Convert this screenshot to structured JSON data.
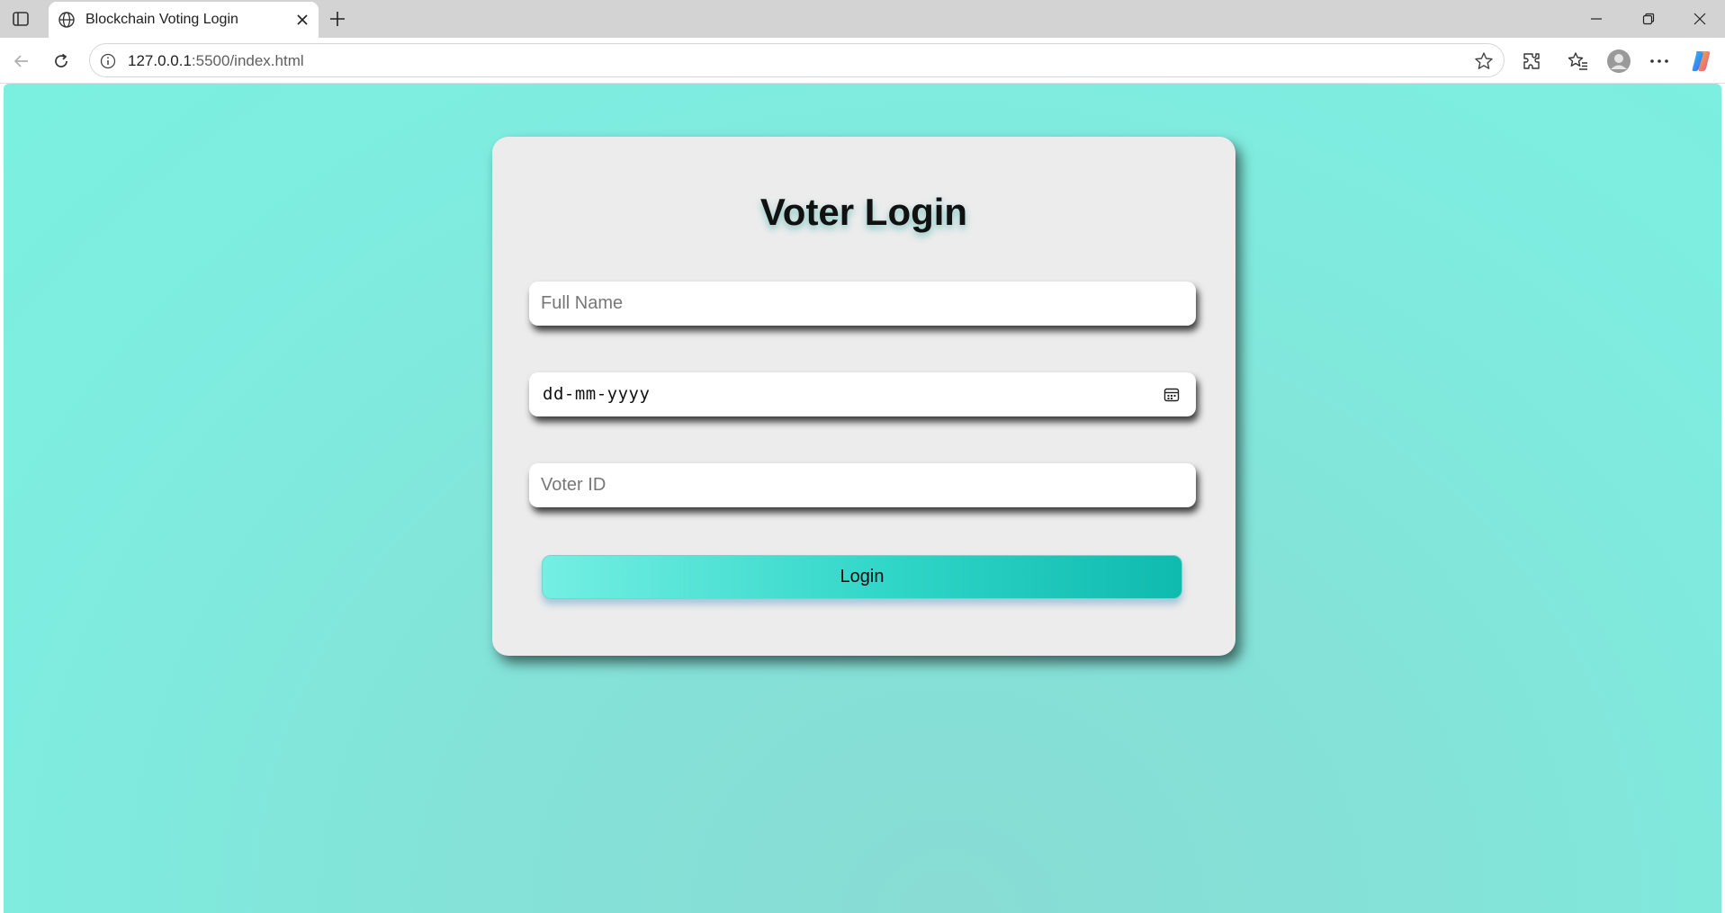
{
  "browser": {
    "tab_title": "Blockchain Voting Login",
    "url_host": "127.0.0.1",
    "url_rest": ":5500/index.html",
    "icons": [
      "sidebar-toggle-icon",
      "globe-icon",
      "close-icon",
      "plus-icon",
      "minimize-icon",
      "restore-icon",
      "window-close-icon",
      "back-icon",
      "reload-icon",
      "info-icon",
      "star-icon",
      "extensions-icon",
      "favorites-icon",
      "profile-icon",
      "more-icon",
      "copilot-icon"
    ]
  },
  "page": {
    "heading": "Voter Login",
    "full_name_placeholder": "Full Name",
    "dob_value": "dd-mm-yyyy",
    "voter_id_placeholder": "Voter ID",
    "login_label": "Login",
    "colors": {
      "background": "#7eede0",
      "card": "#ececec",
      "button_start": "#74efe3",
      "button_end": "#0fbaae"
    }
  }
}
